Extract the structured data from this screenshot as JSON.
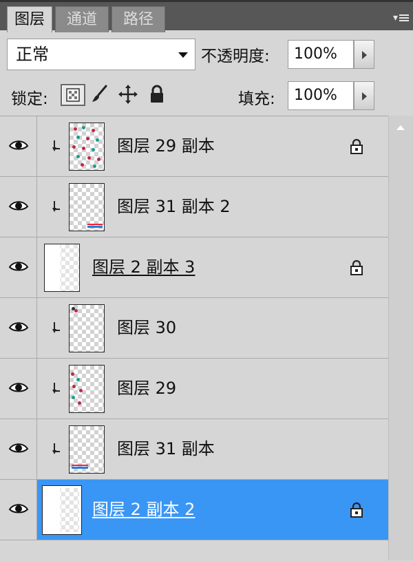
{
  "tabs": [
    {
      "label": "图层",
      "active": true
    },
    {
      "label": "通道",
      "active": false
    },
    {
      "label": "路径",
      "active": false
    }
  ],
  "options": {
    "blend_mode": "正常",
    "opacity_label": "不透明度:",
    "opacity_value": "100%",
    "lock_label": "锁定:",
    "fill_label": "填充:",
    "fill_value": "100%",
    "lock_tools": [
      "lock-transparent-pixels-icon",
      "lock-image-pixels-icon",
      "lock-position-icon",
      "lock-all-icon"
    ]
  },
  "layers": [
    {
      "name": "图层 29 副本",
      "visible": true,
      "clipped": true,
      "locked": true,
      "thumb": "floral",
      "selected": false
    },
    {
      "name": "图层 31 副本 2",
      "visible": true,
      "clipped": true,
      "locked": false,
      "thumb": "transparent-bars",
      "selected": false
    },
    {
      "name": "图层 2 副本 3",
      "visible": true,
      "clipped": false,
      "locked": true,
      "thumb": "plain",
      "selected": false
    },
    {
      "name": "图层 30",
      "visible": true,
      "clipped": true,
      "locked": false,
      "thumb": "transparent-corner",
      "selected": false
    },
    {
      "name": "图层 29",
      "visible": true,
      "clipped": true,
      "locked": false,
      "thumb": "floral-edge",
      "selected": false
    },
    {
      "name": "图层 31 副本",
      "visible": true,
      "clipped": true,
      "locked": false,
      "thumb": "transparent-bars",
      "selected": false
    },
    {
      "name": "图层 2 副本 2",
      "visible": true,
      "clipped": false,
      "locked": true,
      "thumb": "plain-frame",
      "selected": true
    }
  ],
  "colors": {
    "selection": "#3a96f5",
    "panel": "#d6d6d6",
    "tabbar": "#575757"
  }
}
